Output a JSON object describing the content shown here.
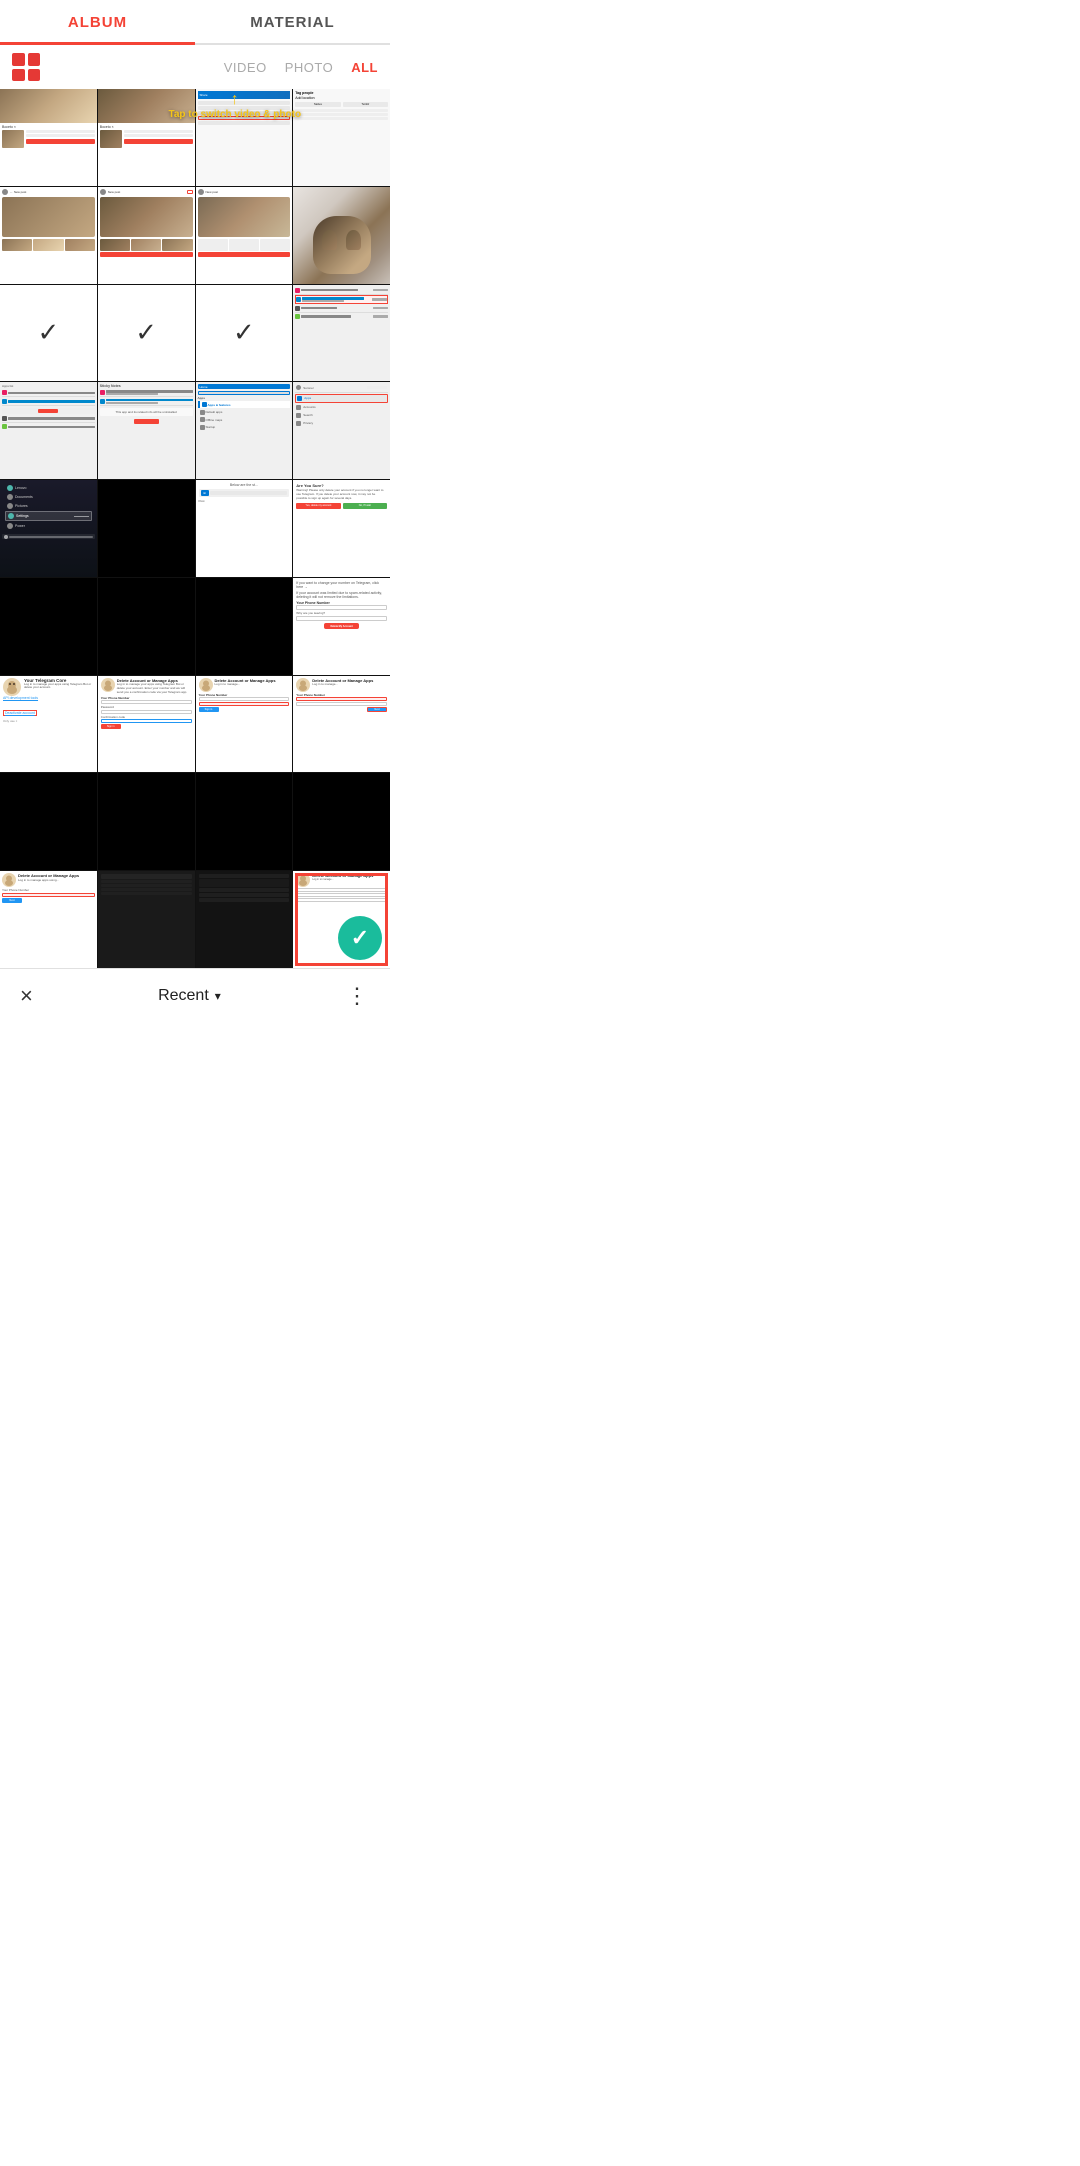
{
  "tabs": {
    "album": "ALBUM",
    "material": "MATERIAL",
    "active": "album"
  },
  "filters": {
    "video": "VIDEO",
    "photo": "PHOTO",
    "all": "ALL",
    "active": "all"
  },
  "hint": {
    "arrow": "↑",
    "text": "Tap to switch video & photo"
  },
  "bottom_bar": {
    "close": "×",
    "recent": "Recent",
    "chevron": "▾",
    "dots": "⋮"
  },
  "grid": {
    "rows": 8
  },
  "colors": {
    "red": "#f44336",
    "teal": "#1abc9c",
    "blue": "#2196f3",
    "selected_border": "#f44336"
  }
}
